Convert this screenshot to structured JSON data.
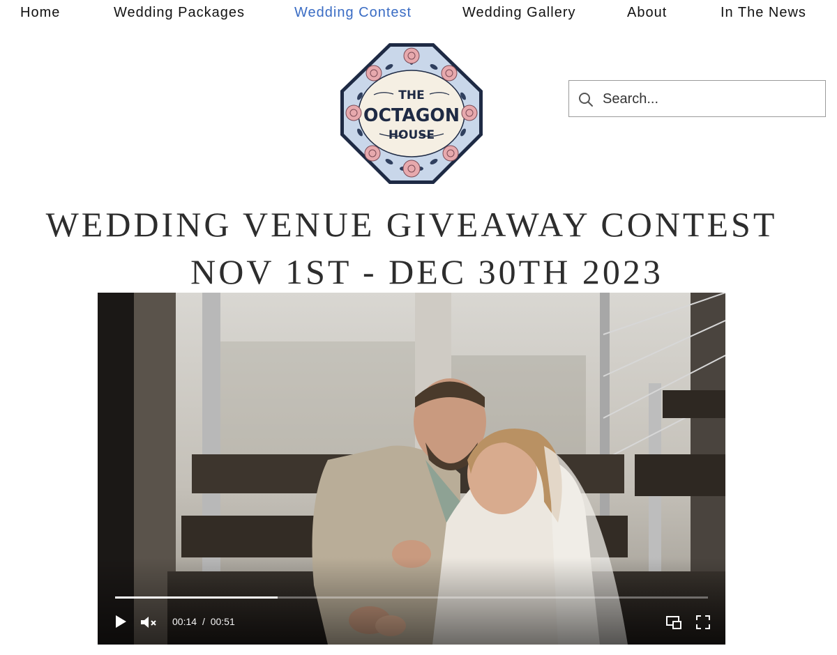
{
  "nav": {
    "items": [
      {
        "label": "Home"
      },
      {
        "label": "Wedding Packages"
      },
      {
        "label": "Wedding Contest",
        "active": true
      },
      {
        "label": "Wedding Gallery"
      },
      {
        "label": "About"
      },
      {
        "label": "In The News"
      }
    ],
    "active_color": "#3a6cc4",
    "text_color": "#111111"
  },
  "logo": {
    "line1": "THE",
    "line2": "OCTAGON",
    "line3": "HOUSE",
    "colors": {
      "border": "#1e2a44",
      "frame": "#c9d7ea",
      "center": "#f5efe3",
      "rose": "#e7a9ad",
      "leaf": "#2f3f5e"
    }
  },
  "search": {
    "placeholder": "Search...",
    "icon": "search-icon"
  },
  "heading": {
    "line1": "WEDDING VENUE GIVEAWAY CONTEST",
    "line2": "NOV 1ST - DEC 30TH 2023"
  },
  "video": {
    "current_time": "00:14",
    "separator": "/",
    "duration": "00:51",
    "progress_fraction": 0.2745,
    "muted": true,
    "icons": [
      "play-icon",
      "volume-muted-icon",
      "picture-in-picture-icon",
      "fullscreen-icon"
    ]
  }
}
